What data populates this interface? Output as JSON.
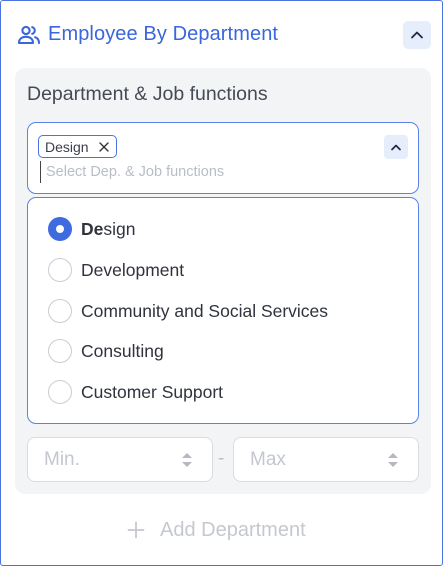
{
  "header": {
    "title": "Employee By Department",
    "icon": "people-icon",
    "collapse_icon": "chevron-up-icon"
  },
  "section": {
    "label": "Department & Job functions"
  },
  "select": {
    "chips": [
      {
        "label": "Design",
        "remove_icon": "close-icon"
      }
    ],
    "placeholder": "Select Dep. & Job functions",
    "toggle_icon": "chevron-up-icon"
  },
  "options": [
    {
      "label_bold": "De",
      "label_rest": "sign",
      "selected": true
    },
    {
      "label_bold": "",
      "label_rest": "Development",
      "selected": false
    },
    {
      "label_bold": "",
      "label_rest": "Community and Social Services",
      "selected": false
    },
    {
      "label_bold": "",
      "label_rest": "Consulting",
      "selected": false
    },
    {
      "label_bold": "",
      "label_rest": "Customer Support",
      "selected": false
    }
  ],
  "range": {
    "min_placeholder": "Min.",
    "max_placeholder": "Max",
    "separator": "-"
  },
  "add_button": {
    "label": "Add Department",
    "icon": "plus-icon"
  },
  "colors": {
    "accent": "#3a66dd",
    "accent_light": "#e6eefc",
    "panel_bg": "#f3f4f6",
    "muted_text": "#c4c8cf"
  }
}
